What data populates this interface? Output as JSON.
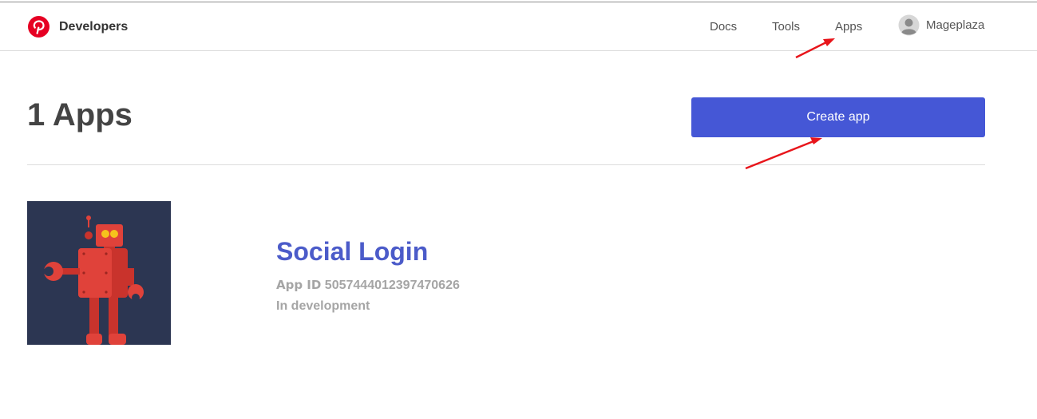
{
  "header": {
    "brand_name": "Developers",
    "nav": {
      "docs": "Docs",
      "tools": "Tools",
      "apps": "Apps"
    },
    "user_name": "Mageplaza"
  },
  "main": {
    "title": "1 Apps",
    "create_button_label": "Create app"
  },
  "apps": [
    {
      "name": "Social Login",
      "id_label": "App ID",
      "id_value": "5057444012397470626",
      "status": "In development"
    }
  ],
  "colors": {
    "brand_red": "#e60023",
    "primary_button": "#4557d6",
    "app_link": "#4b5bc9",
    "annotation_arrow": "#e8151b",
    "thumb_background": "#2c3652",
    "robot": "#e0423a"
  },
  "icons": {
    "logo": "pinterest-logo-icon",
    "avatar": "user-avatar-icon",
    "app": "robot-icon"
  }
}
